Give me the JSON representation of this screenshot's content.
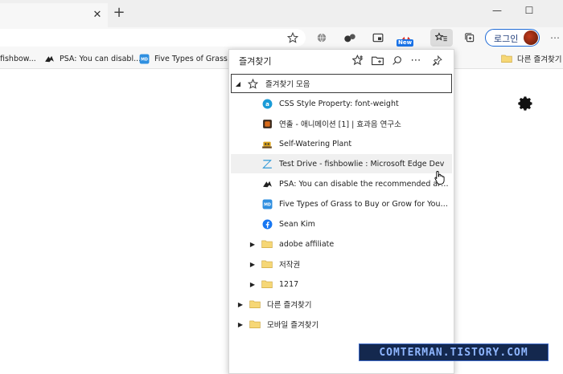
{
  "tab": {
    "close": "✕"
  },
  "new_tab": "+",
  "window": {
    "minimize": "—",
    "maximize": "☐"
  },
  "toolbar": {
    "new_badge": "New",
    "login_label": "로그인"
  },
  "favorites_bar": {
    "items": [
      {
        "label": "fishbow...",
        "icon": "none"
      },
      {
        "label": "PSA: You can disabl...",
        "icon": "bird-icon"
      },
      {
        "label": "Five Types of Grass...",
        "icon": "md-icon"
      }
    ],
    "other_favorites": "다른 즐겨찾기"
  },
  "panel": {
    "title": "즐겨찾기",
    "root_folder": "즐겨찾기 모음",
    "items": [
      {
        "label": "CSS Style Property: font-weight",
        "icon": "a-circle-icon",
        "color": "#1a9bd7"
      },
      {
        "label": "연출 - 애니메이션 [1] | 효과음 연구소",
        "icon": "box-icon",
        "color": "#d86b1a"
      },
      {
        "label": "Self-Watering Plant",
        "icon": "robot-icon",
        "color": "#d9a21b"
      },
      {
        "label": "Test Drive - fishbowlie : Microsoft Edge Dev",
        "icon": "edge-z-icon",
        "color": "#1b8fd6"
      },
      {
        "label": "PSA: You can disable the recommended artic...",
        "icon": "bird-icon",
        "color": "#222222"
      },
      {
        "label": "Five Types of Grass to Buy or Grow for Your Ca...",
        "icon": "md-icon",
        "color": "#2f8fe0"
      },
      {
        "label": "Sean Kim",
        "icon": "facebook-icon",
        "color": "#1877f2"
      }
    ],
    "subfolders": [
      {
        "label": "adobe affiliate"
      },
      {
        "label": "저작권"
      },
      {
        "label": "1217"
      }
    ],
    "top_folders": [
      {
        "label": "다른 즐겨찾기"
      },
      {
        "label": "모바일 즐겨찾기"
      }
    ]
  },
  "watermark": "COMTERMAN.TISTORY.COM"
}
